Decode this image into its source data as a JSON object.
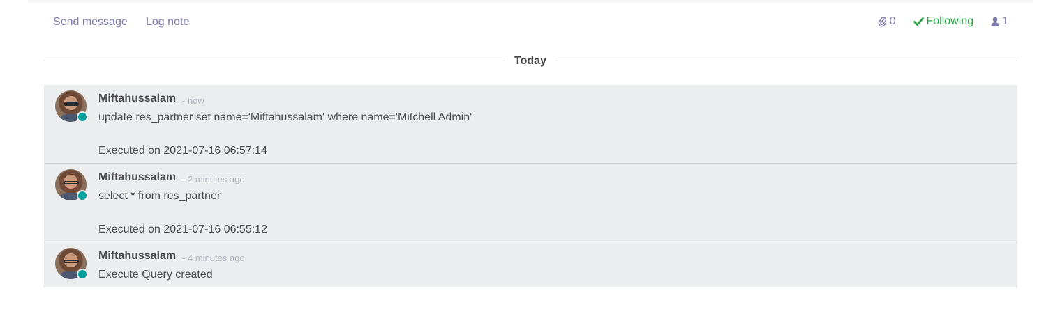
{
  "chatter": {
    "send_message": "Send message",
    "log_note": "Log note",
    "attachments_count": "0",
    "following_label": "Following",
    "followers_count": "1",
    "colors": {
      "link": "#7c7bad",
      "following": "#28a745",
      "presence": "#00a09d"
    }
  },
  "divider": {
    "label": "Today"
  },
  "messages": [
    {
      "author": "Miftahussalam",
      "date": "- now",
      "line1": "update res_partner set name='Miftahussalam' where name='Mitchell Admin'",
      "line2": "Executed on 2021-07-16 06:57:14"
    },
    {
      "author": "Miftahussalam",
      "date": "- 2 minutes ago",
      "line1": "select * from res_partner",
      "line2": "Executed on 2021-07-16 06:55:12"
    },
    {
      "author": "Miftahussalam",
      "date": "- 4 minutes ago",
      "line1": "Execute Query created"
    }
  ]
}
